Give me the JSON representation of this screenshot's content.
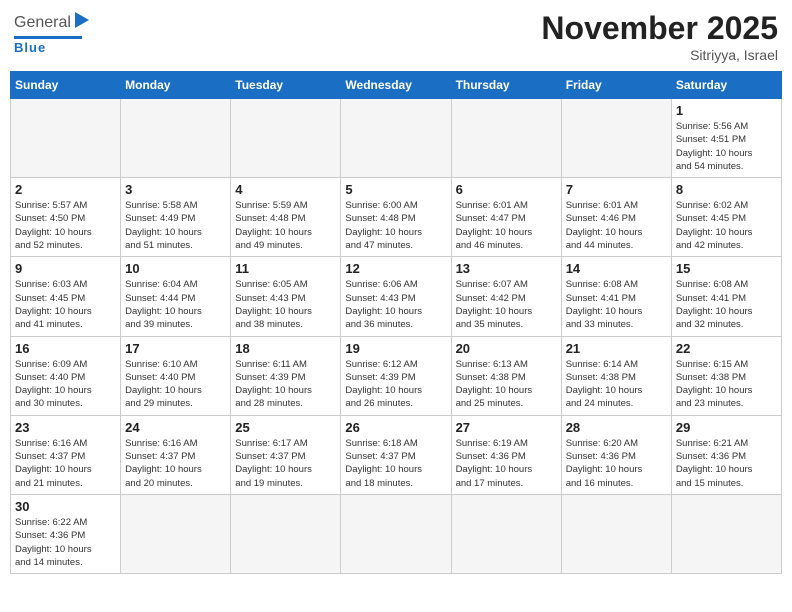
{
  "header": {
    "logo_general": "General",
    "logo_blue": "Blue",
    "month_title": "November 2025",
    "location": "Sitriyya, Israel"
  },
  "weekdays": [
    "Sunday",
    "Monday",
    "Tuesday",
    "Wednesday",
    "Thursday",
    "Friday",
    "Saturday"
  ],
  "weeks": [
    [
      {
        "day": "",
        "info": ""
      },
      {
        "day": "",
        "info": ""
      },
      {
        "day": "",
        "info": ""
      },
      {
        "day": "",
        "info": ""
      },
      {
        "day": "",
        "info": ""
      },
      {
        "day": "",
        "info": ""
      },
      {
        "day": "1",
        "info": "Sunrise: 5:56 AM\nSunset: 4:51 PM\nDaylight: 10 hours\nand 54 minutes."
      }
    ],
    [
      {
        "day": "2",
        "info": "Sunrise: 5:57 AM\nSunset: 4:50 PM\nDaylight: 10 hours\nand 52 minutes."
      },
      {
        "day": "3",
        "info": "Sunrise: 5:58 AM\nSunset: 4:49 PM\nDaylight: 10 hours\nand 51 minutes."
      },
      {
        "day": "4",
        "info": "Sunrise: 5:59 AM\nSunset: 4:48 PM\nDaylight: 10 hours\nand 49 minutes."
      },
      {
        "day": "5",
        "info": "Sunrise: 6:00 AM\nSunset: 4:48 PM\nDaylight: 10 hours\nand 47 minutes."
      },
      {
        "day": "6",
        "info": "Sunrise: 6:01 AM\nSunset: 4:47 PM\nDaylight: 10 hours\nand 46 minutes."
      },
      {
        "day": "7",
        "info": "Sunrise: 6:01 AM\nSunset: 4:46 PM\nDaylight: 10 hours\nand 44 minutes."
      },
      {
        "day": "8",
        "info": "Sunrise: 6:02 AM\nSunset: 4:45 PM\nDaylight: 10 hours\nand 42 minutes."
      }
    ],
    [
      {
        "day": "9",
        "info": "Sunrise: 6:03 AM\nSunset: 4:45 PM\nDaylight: 10 hours\nand 41 minutes."
      },
      {
        "day": "10",
        "info": "Sunrise: 6:04 AM\nSunset: 4:44 PM\nDaylight: 10 hours\nand 39 minutes."
      },
      {
        "day": "11",
        "info": "Sunrise: 6:05 AM\nSunset: 4:43 PM\nDaylight: 10 hours\nand 38 minutes."
      },
      {
        "day": "12",
        "info": "Sunrise: 6:06 AM\nSunset: 4:43 PM\nDaylight: 10 hours\nand 36 minutes."
      },
      {
        "day": "13",
        "info": "Sunrise: 6:07 AM\nSunset: 4:42 PM\nDaylight: 10 hours\nand 35 minutes."
      },
      {
        "day": "14",
        "info": "Sunrise: 6:08 AM\nSunset: 4:41 PM\nDaylight: 10 hours\nand 33 minutes."
      },
      {
        "day": "15",
        "info": "Sunrise: 6:08 AM\nSunset: 4:41 PM\nDaylight: 10 hours\nand 32 minutes."
      }
    ],
    [
      {
        "day": "16",
        "info": "Sunrise: 6:09 AM\nSunset: 4:40 PM\nDaylight: 10 hours\nand 30 minutes."
      },
      {
        "day": "17",
        "info": "Sunrise: 6:10 AM\nSunset: 4:40 PM\nDaylight: 10 hours\nand 29 minutes."
      },
      {
        "day": "18",
        "info": "Sunrise: 6:11 AM\nSunset: 4:39 PM\nDaylight: 10 hours\nand 28 minutes."
      },
      {
        "day": "19",
        "info": "Sunrise: 6:12 AM\nSunset: 4:39 PM\nDaylight: 10 hours\nand 26 minutes."
      },
      {
        "day": "20",
        "info": "Sunrise: 6:13 AM\nSunset: 4:38 PM\nDaylight: 10 hours\nand 25 minutes."
      },
      {
        "day": "21",
        "info": "Sunrise: 6:14 AM\nSunset: 4:38 PM\nDaylight: 10 hours\nand 24 minutes."
      },
      {
        "day": "22",
        "info": "Sunrise: 6:15 AM\nSunset: 4:38 PM\nDaylight: 10 hours\nand 23 minutes."
      }
    ],
    [
      {
        "day": "23",
        "info": "Sunrise: 6:16 AM\nSunset: 4:37 PM\nDaylight: 10 hours\nand 21 minutes."
      },
      {
        "day": "24",
        "info": "Sunrise: 6:16 AM\nSunset: 4:37 PM\nDaylight: 10 hours\nand 20 minutes."
      },
      {
        "day": "25",
        "info": "Sunrise: 6:17 AM\nSunset: 4:37 PM\nDaylight: 10 hours\nand 19 minutes."
      },
      {
        "day": "26",
        "info": "Sunrise: 6:18 AM\nSunset: 4:37 PM\nDaylight: 10 hours\nand 18 minutes."
      },
      {
        "day": "27",
        "info": "Sunrise: 6:19 AM\nSunset: 4:36 PM\nDaylight: 10 hours\nand 17 minutes."
      },
      {
        "day": "28",
        "info": "Sunrise: 6:20 AM\nSunset: 4:36 PM\nDaylight: 10 hours\nand 16 minutes."
      },
      {
        "day": "29",
        "info": "Sunrise: 6:21 AM\nSunset: 4:36 PM\nDaylight: 10 hours\nand 15 minutes."
      }
    ],
    [
      {
        "day": "30",
        "info": "Sunrise: 6:22 AM\nSunset: 4:36 PM\nDaylight: 10 hours\nand 14 minutes."
      },
      {
        "day": "",
        "info": ""
      },
      {
        "day": "",
        "info": ""
      },
      {
        "day": "",
        "info": ""
      },
      {
        "day": "",
        "info": ""
      },
      {
        "day": "",
        "info": ""
      },
      {
        "day": "",
        "info": ""
      }
    ]
  ]
}
